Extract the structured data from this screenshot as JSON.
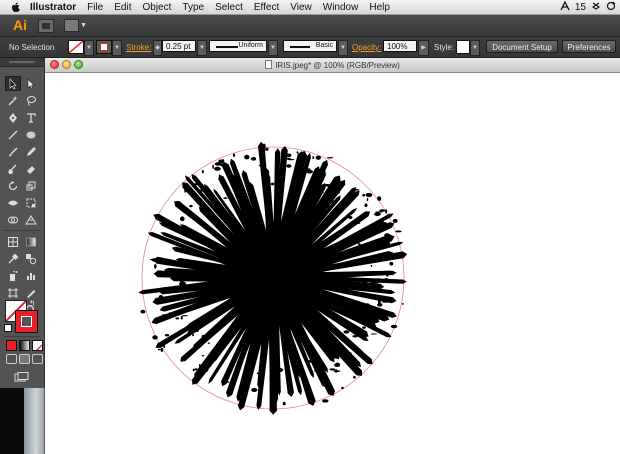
{
  "menubar": {
    "app_name": "Illustrator",
    "items": [
      "File",
      "Edit",
      "Object",
      "Type",
      "Select",
      "Effect",
      "View",
      "Window",
      "Help"
    ],
    "status_number": "15"
  },
  "appbar": {
    "logo": "Ai"
  },
  "control": {
    "selection": "No Selection",
    "stroke_label": "Stroke:",
    "stroke_weight": "0.25 pt",
    "profile_uniform": "Uniform",
    "brush_basic": "Basic",
    "opacity_label": "Opacity:",
    "opacity_value": "100%",
    "style_label": "Style:",
    "document_setup": "Document Setup",
    "preferences": "Preferences"
  },
  "document": {
    "title": "IRIS.jpeg* @ 100% (RGB/Preview)"
  },
  "colors": {
    "accent_orange": "#f0a030",
    "stroke_red": "#e8202c",
    "guide_circle": "#f08080"
  }
}
